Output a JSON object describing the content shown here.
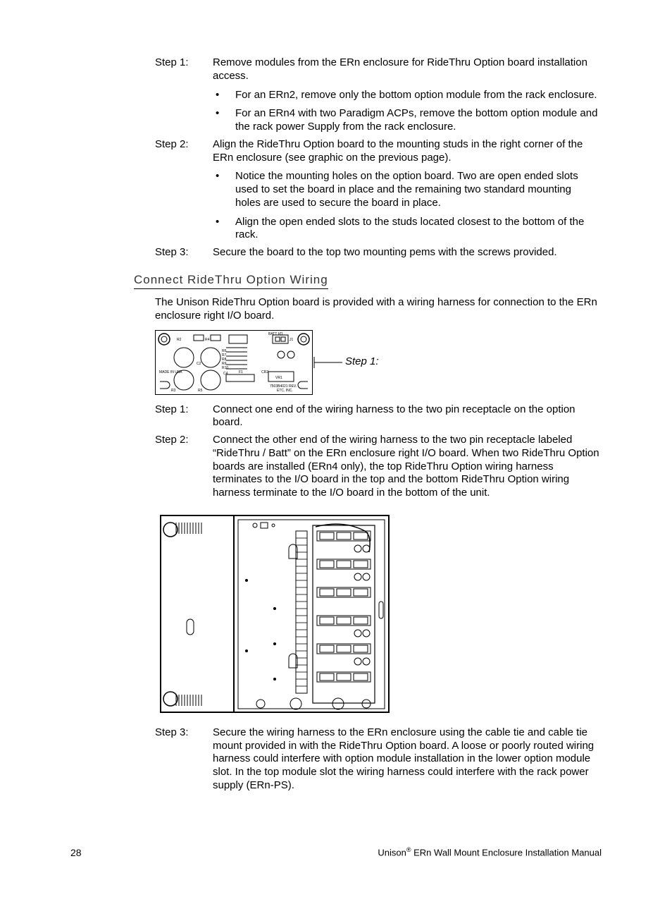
{
  "stepsA": [
    {
      "label": "Step 1:",
      "text": "Remove modules from the ERn enclosure for RideThru Option board installation access."
    },
    {
      "label": "Step 2:",
      "text": "Align the RideThru Option board to the mounting studs in the right corner of the ERn enclosure (see graphic on the previous page)."
    },
    {
      "label": "Step 3:",
      "text": "Secure the board to the top two mounting pems with the screws provided."
    }
  ],
  "bulletsA1": [
    "For an ERn2, remove only the bottom option module from the rack enclosure.",
    "For an ERn4 with two Paradigm ACPs, remove the bottom option module and the rack power Supply from the rack enclosure."
  ],
  "bulletsA2": [
    "Notice the mounting holes on the option board. Two are open ended slots used to set the board in place and the remaining two standard mounting holes are used to secure the board in place.",
    "Align the open ended slots to the studs located closest to the bottom of the rack."
  ],
  "sectionHeading": "Connect RideThru Option Wiring",
  "introPara": "The Unison RideThru Option board is provided with a wiring harness for connection to the ERn enclosure right I/O board.",
  "figLabel": "Step 1:",
  "stepsB": [
    {
      "label": "Step 1:",
      "text": "Connect one end of the wiring harness to the two pin receptacle on the option board."
    },
    {
      "label": "Step 2:",
      "text": "Connect the other end of the wiring harness to the two pin receptacle labeled “RideThru / Batt” on the ERn enclosure right I/O board. When two RideThru Option boards are installed (ERn4 only), the top RideThru Option wiring harness terminates to the I/O board in the top and the bottom RideThru Option wiring harness terminate to the I/O board in the bottom of the unit."
    },
    {
      "label": "Step 3:",
      "text": "Secure the wiring harness to the ERn enclosure using the cable tie and cable tie mount provided in with the RideThru Option board. A loose or poorly routed wiring harness could interfere with option module installation in the lower option module slot. In the top module slot the wiring harness could interfere with the rack power supply (ERn-PS)."
    }
  ],
  "boardLabels": {
    "madeIn": "MADE IN USA",
    "rev": "7503B4021 REV.",
    "etc": "ETC, INC.",
    "j1": "J1",
    "batt": "BATT I/O"
  },
  "footer": {
    "pageNum": "28",
    "product": "Unison",
    "suffix": " ERn Wall Mount Enclosure Installation Manual",
    "reg": "®"
  }
}
